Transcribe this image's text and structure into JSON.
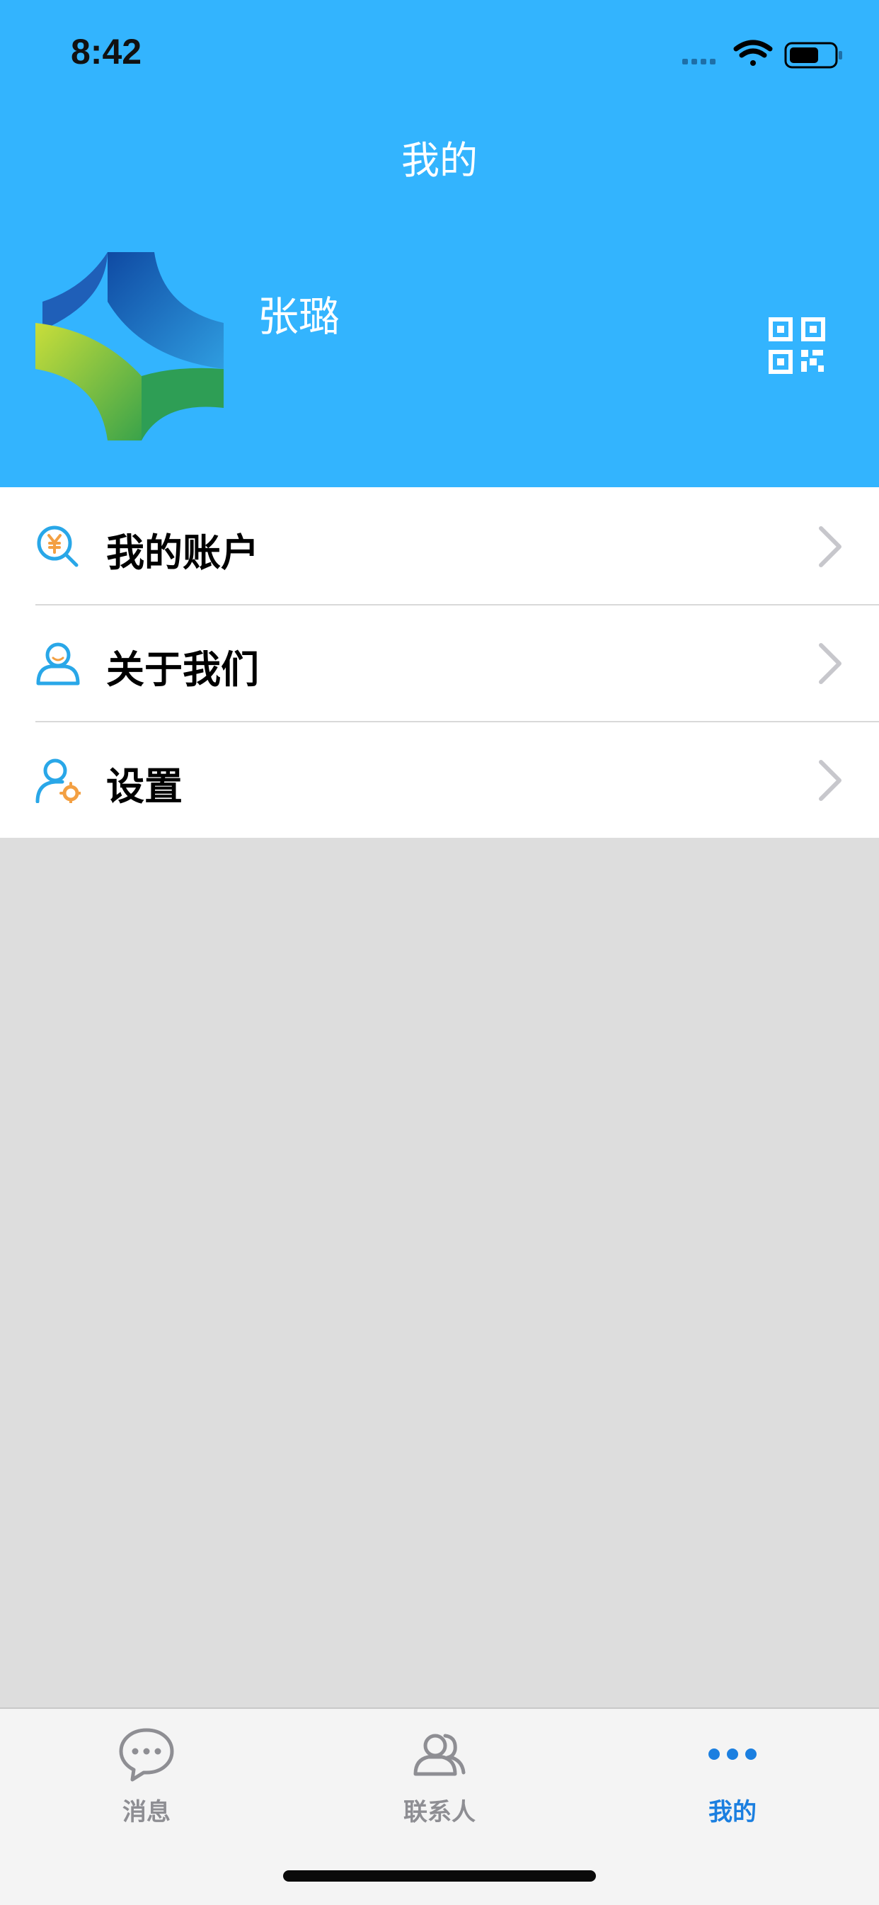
{
  "status_bar": {
    "time": "8:42"
  },
  "header": {
    "title": "我的",
    "user_name": "张璐"
  },
  "menu": {
    "items": [
      {
        "label": "我的账户",
        "icon": "account-search-icon"
      },
      {
        "label": "关于我们",
        "icon": "user-icon"
      },
      {
        "label": "设置",
        "icon": "user-settings-icon"
      }
    ]
  },
  "tabbar": {
    "tabs": [
      {
        "label": "消息",
        "icon": "chat-bubble-icon",
        "active": false
      },
      {
        "label": "联系人",
        "icon": "contacts-icon",
        "active": false
      },
      {
        "label": "我的",
        "icon": "more-dots-icon",
        "active": true
      }
    ]
  },
  "colors": {
    "header_bg": "#33b4fe",
    "accent": "#1b7fe0",
    "inactive_tab": "#8e8e93",
    "content_bg": "#dddddd"
  }
}
